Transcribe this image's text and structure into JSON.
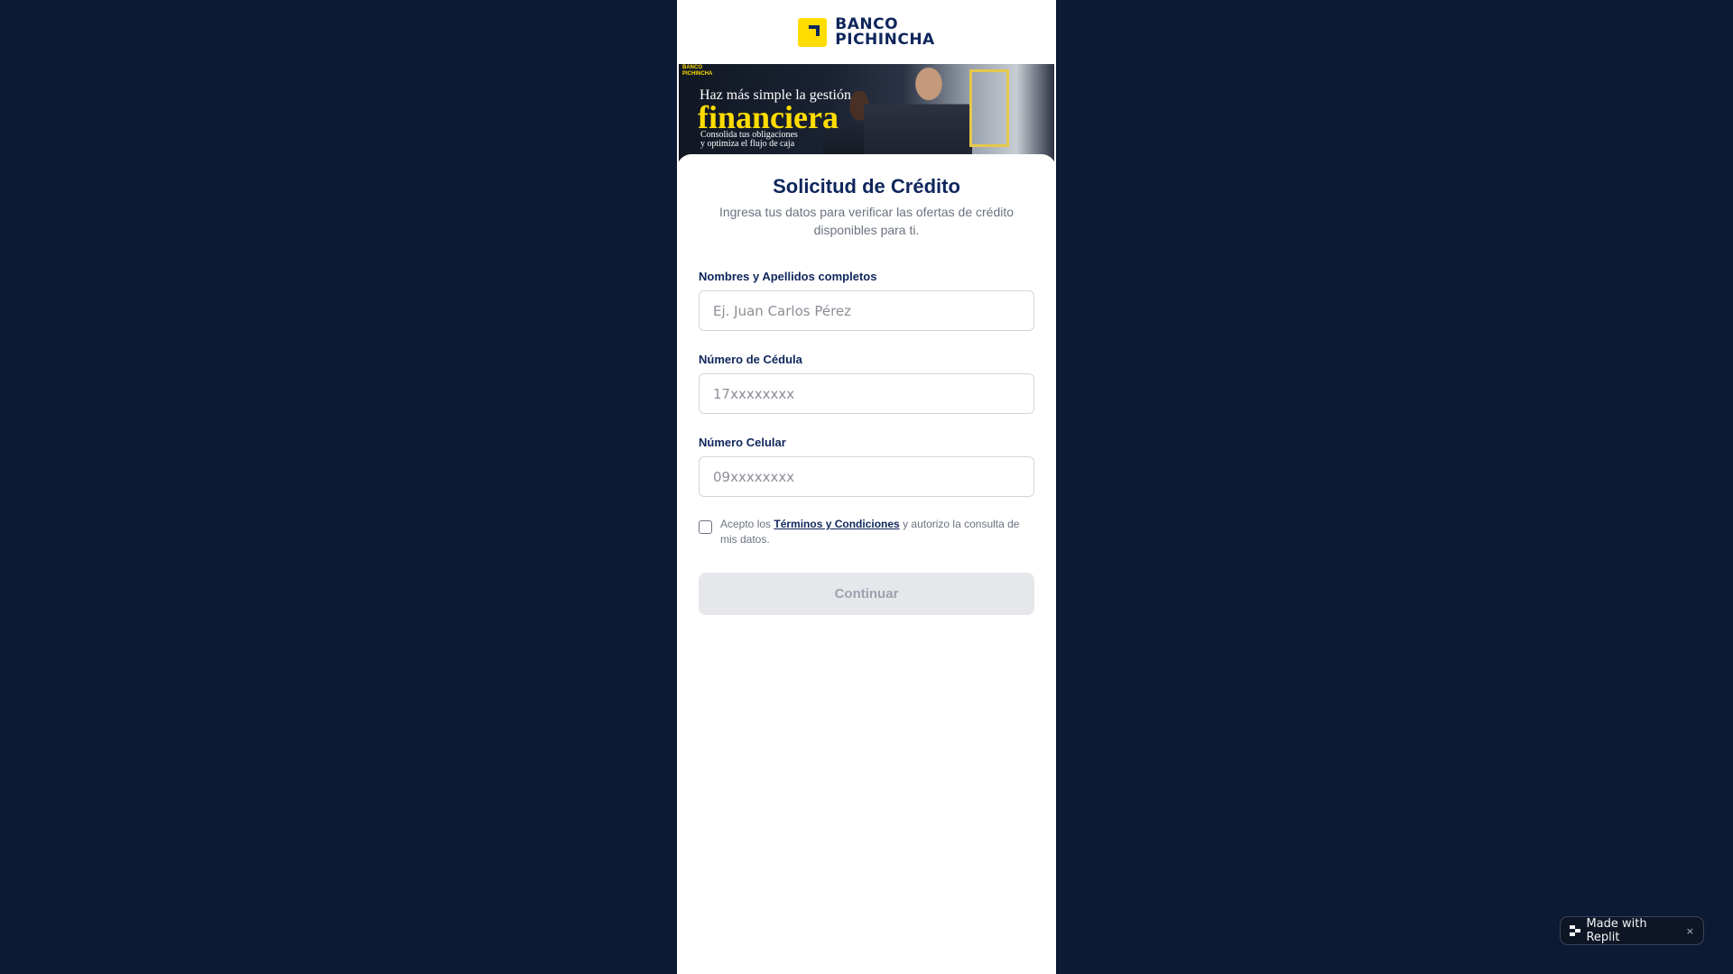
{
  "logo": {
    "line1": "BANCO",
    "line2": "PICHINCHA"
  },
  "banner": {
    "brand_small_line1": "BANCO",
    "brand_small_line2": "PICHINCHA",
    "subtitle": "Haz más simple la gestión",
    "headline": "financiera",
    "foot_line1": "Consolida tus obligaciones",
    "foot_line2": "y optimiza el flujo de caja"
  },
  "form": {
    "title": "Solicitud de Crédito",
    "subtitle": "Ingresa tus datos para verificar las ofertas de crédito disponibles para ti.",
    "fields": [
      {
        "label": "Nombres y Apellidos completos",
        "placeholder": "Ej. Juan Carlos Pérez",
        "value": ""
      },
      {
        "label": "Número de Cédula",
        "placeholder": "17xxxxxxxx",
        "value": ""
      },
      {
        "label": "Número Celular",
        "placeholder": "09xxxxxxxx",
        "value": ""
      }
    ],
    "terms": {
      "checked": false,
      "prefix": "Acepto los ",
      "link": "Términos y Condiciones",
      "suffix": " y autorizo la consulta de mis datos."
    },
    "submit_label": "Continuar"
  },
  "replit_badge": {
    "label": "Made with Replit",
    "close": "×"
  },
  "colors": {
    "page_background": "#0c1a33",
    "brand_navy": "#0f265c",
    "brand_yellow": "#ffdd00",
    "button_disabled": "#e5e7eb"
  }
}
